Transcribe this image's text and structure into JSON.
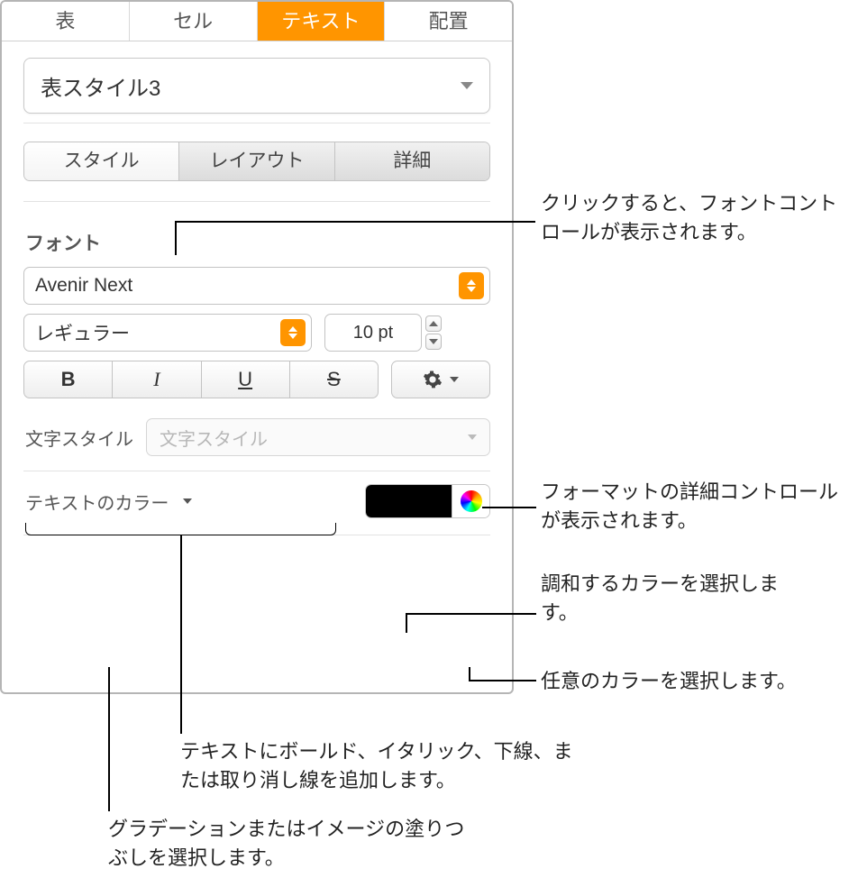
{
  "topTabs": {
    "table": "表",
    "cell": "セル",
    "text": "テキスト",
    "arrange": "配置"
  },
  "styleDropdown": "表スタイル3",
  "segTabs": {
    "style": "スタイル",
    "layout": "レイアウト",
    "detail": "詳細"
  },
  "fontSection": {
    "heading": "フォント",
    "fontFamily": "Avenir Next",
    "fontWeight": "レギュラー",
    "fontSize": "10 pt"
  },
  "charStyle": {
    "label": "文字スタイル",
    "placeholder": "文字スタイル"
  },
  "textColor": {
    "label": "テキストのカラー"
  },
  "callouts": {
    "styleTab": "クリックすると、フォントコントロールが表示されます。",
    "gear": "フォーマットの詳細コントロールが表示されます。",
    "swatch": "調和するカラーを選択します。",
    "wheel": "任意のカラーを選択します。",
    "bisu": "テキストにボールド、イタリック、下線、または取り消し線を追加します。",
    "colorLabel": "グラデーションまたはイメージの塗りつぶしを選択します。"
  }
}
